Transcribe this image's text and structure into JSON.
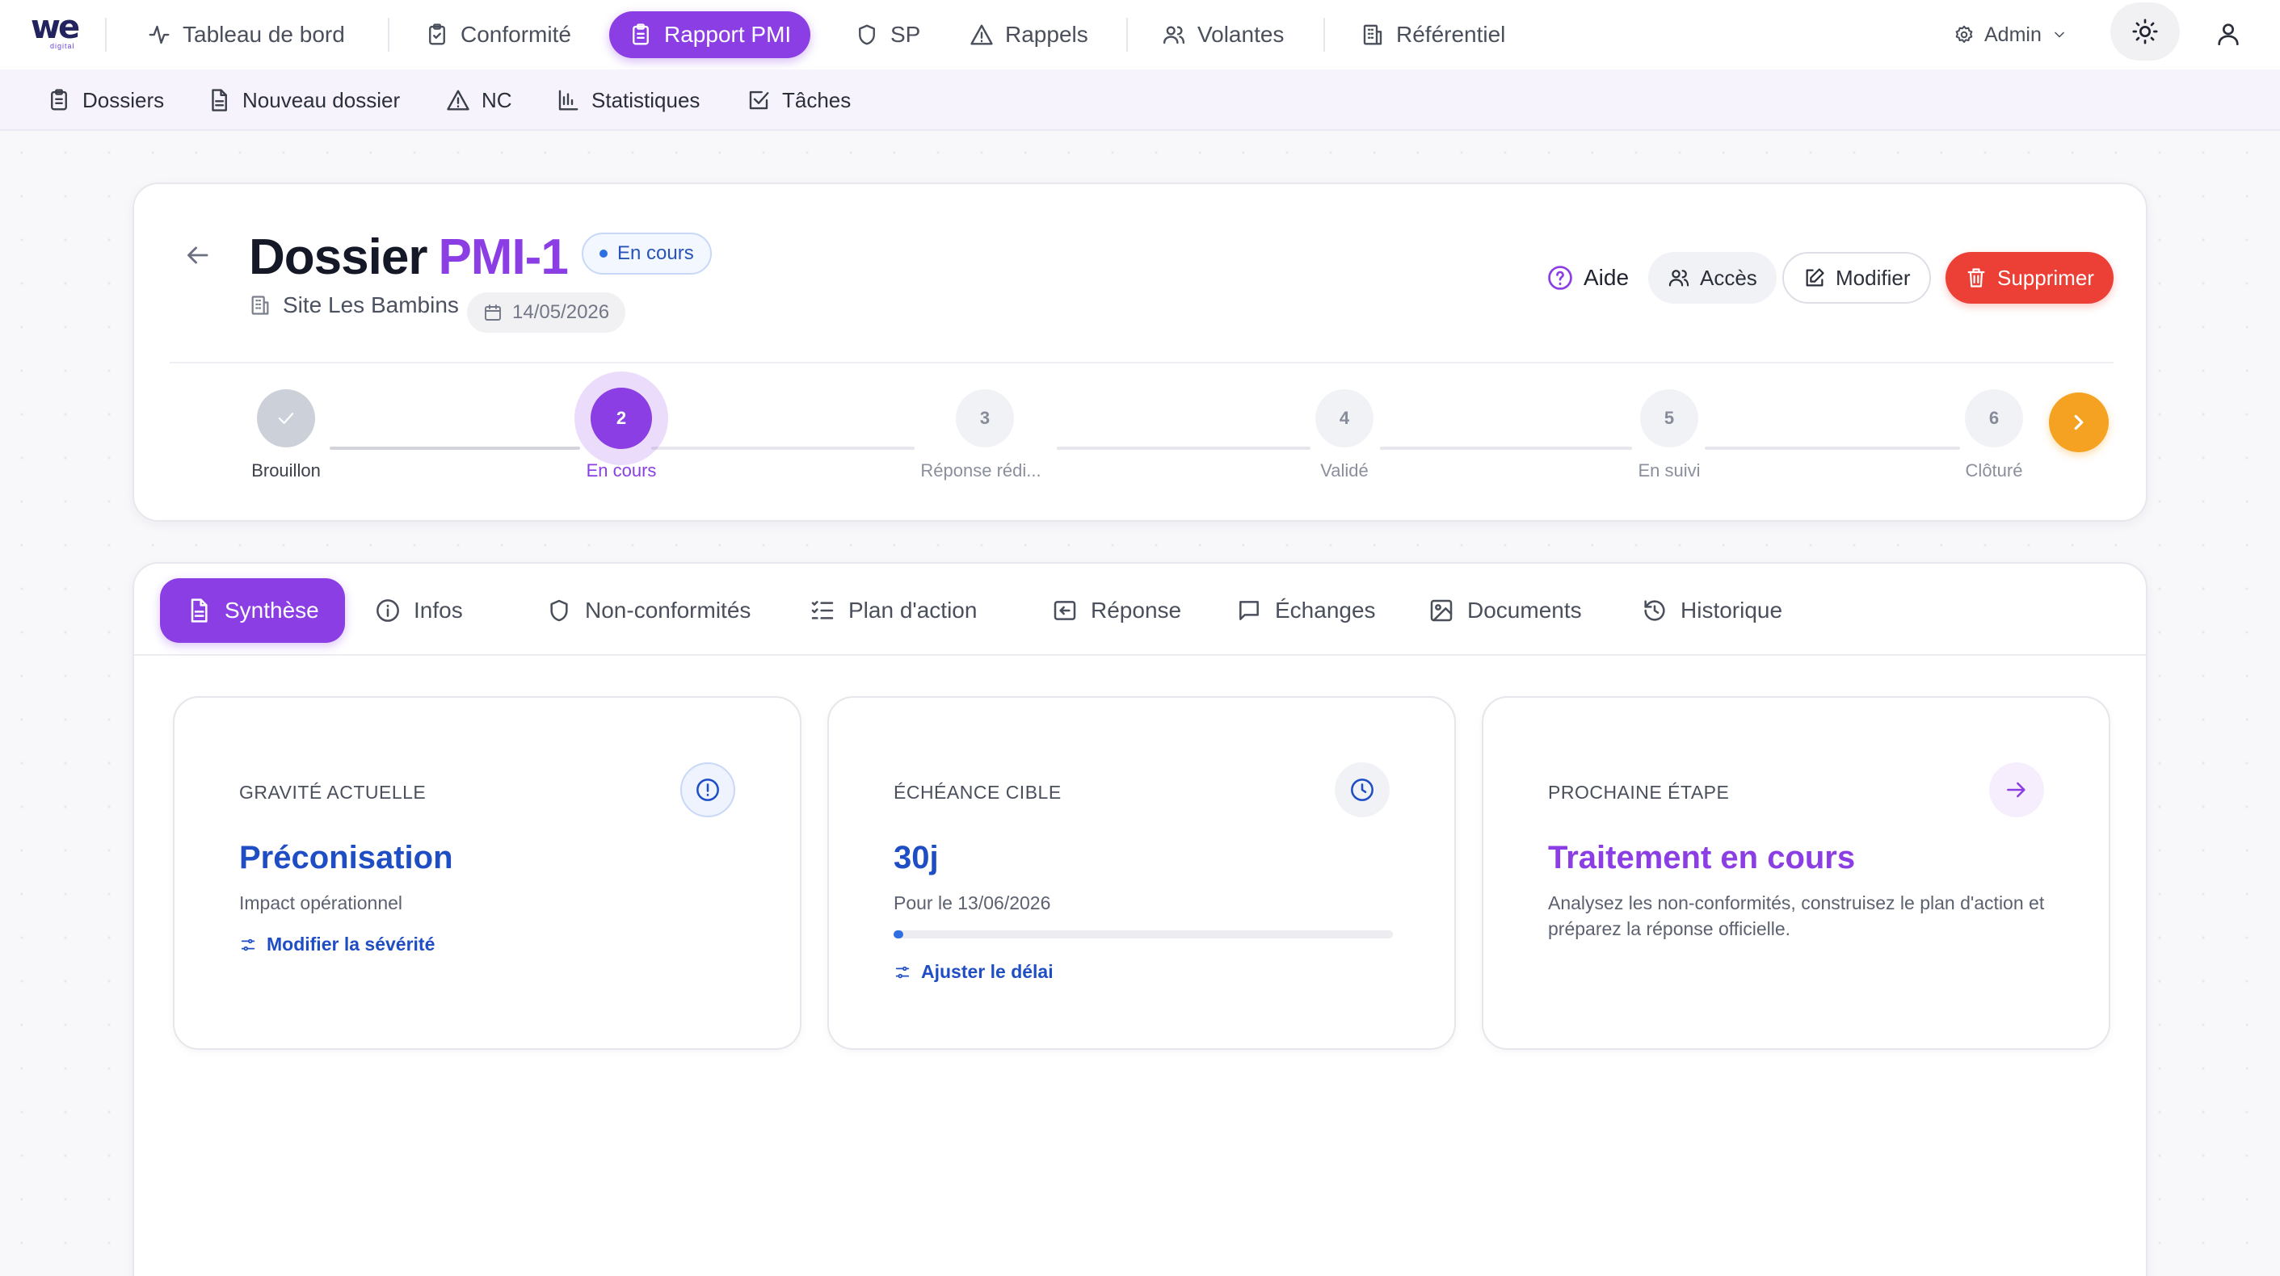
{
  "brand": {
    "logo_text": "we",
    "logo_sub": "digital"
  },
  "topnav": {
    "items": [
      {
        "label": "Tableau de bord",
        "icon": "activity-icon"
      },
      {
        "label": "Conformité",
        "icon": "clipboard-check-icon"
      },
      {
        "label": "Rapport PMI",
        "icon": "clipboard-list-icon",
        "active": true
      },
      {
        "label": "SP",
        "icon": "shield-icon"
      },
      {
        "label": "Rappels",
        "icon": "warning-icon"
      },
      {
        "label": "Volantes",
        "icon": "users-icon"
      },
      {
        "label": "Référentiel",
        "icon": "building-icon"
      }
    ],
    "admin_label": "Admin"
  },
  "subnav": {
    "items": [
      {
        "label": "Dossiers",
        "icon": "clipboard-icon"
      },
      {
        "label": "Nouveau dossier",
        "icon": "file-icon"
      },
      {
        "label": "NC",
        "icon": "warning-icon"
      },
      {
        "label": "Statistiques",
        "icon": "bar-chart-icon"
      },
      {
        "label": "Tâches",
        "icon": "check-square-icon"
      }
    ]
  },
  "dossier": {
    "title_prefix": "Dossier",
    "code": "PMI-1",
    "status": "En cours",
    "site": "Site Les Bambins",
    "date": "14/05/2026",
    "actions": {
      "help": "Aide",
      "access": "Accès",
      "edit": "Modifier",
      "delete": "Supprimer"
    }
  },
  "stepper": {
    "steps": [
      {
        "number": "1",
        "label": "Brouillon",
        "state": "done"
      },
      {
        "number": "2",
        "label": "En cours",
        "state": "active"
      },
      {
        "number": "3",
        "label": "Réponse rédi...",
        "state": "pending"
      },
      {
        "number": "4",
        "label": "Validé",
        "state": "pending"
      },
      {
        "number": "5",
        "label": "En suivi",
        "state": "pending"
      },
      {
        "number": "6",
        "label": "Clôturé",
        "state": "pending"
      }
    ]
  },
  "tabs": [
    {
      "label": "Synthèse",
      "icon": "file-text-icon",
      "active": true
    },
    {
      "label": "Infos",
      "icon": "info-icon"
    },
    {
      "label": "Non-conformités",
      "icon": "shield-icon"
    },
    {
      "label": "Plan d'action",
      "icon": "list-check-icon"
    },
    {
      "label": "Réponse",
      "icon": "reply-icon"
    },
    {
      "label": "Échanges",
      "icon": "message-icon"
    },
    {
      "label": "Documents",
      "icon": "image-icon"
    },
    {
      "label": "Historique",
      "icon": "history-icon"
    }
  ],
  "summary": {
    "severity": {
      "label": "GRAVITÉ ACTUELLE",
      "value": "Préconisation",
      "sub": "Impact opérationnel",
      "link": "Modifier la sévérité",
      "color": "#1f4ec4"
    },
    "deadline": {
      "label": "ÉCHÉANCE CIBLE",
      "value": "30j",
      "sub": "Pour le 13/06/2026",
      "progress": 0.02,
      "link": "Ajuster le délai",
      "color": "#1f4ec4"
    },
    "next": {
      "label": "PROCHAINE ÉTAPE",
      "value": "Traitement en cours",
      "sub": "Analysez les non-conformités, construisez le plan d'action et préparez la réponse officielle.",
      "color": "#8b3ee3"
    }
  },
  "colors": {
    "accent": "#8b3ee3",
    "danger": "#ec3f36",
    "next_step": "#f5a223",
    "link": "#1f4ec4"
  }
}
